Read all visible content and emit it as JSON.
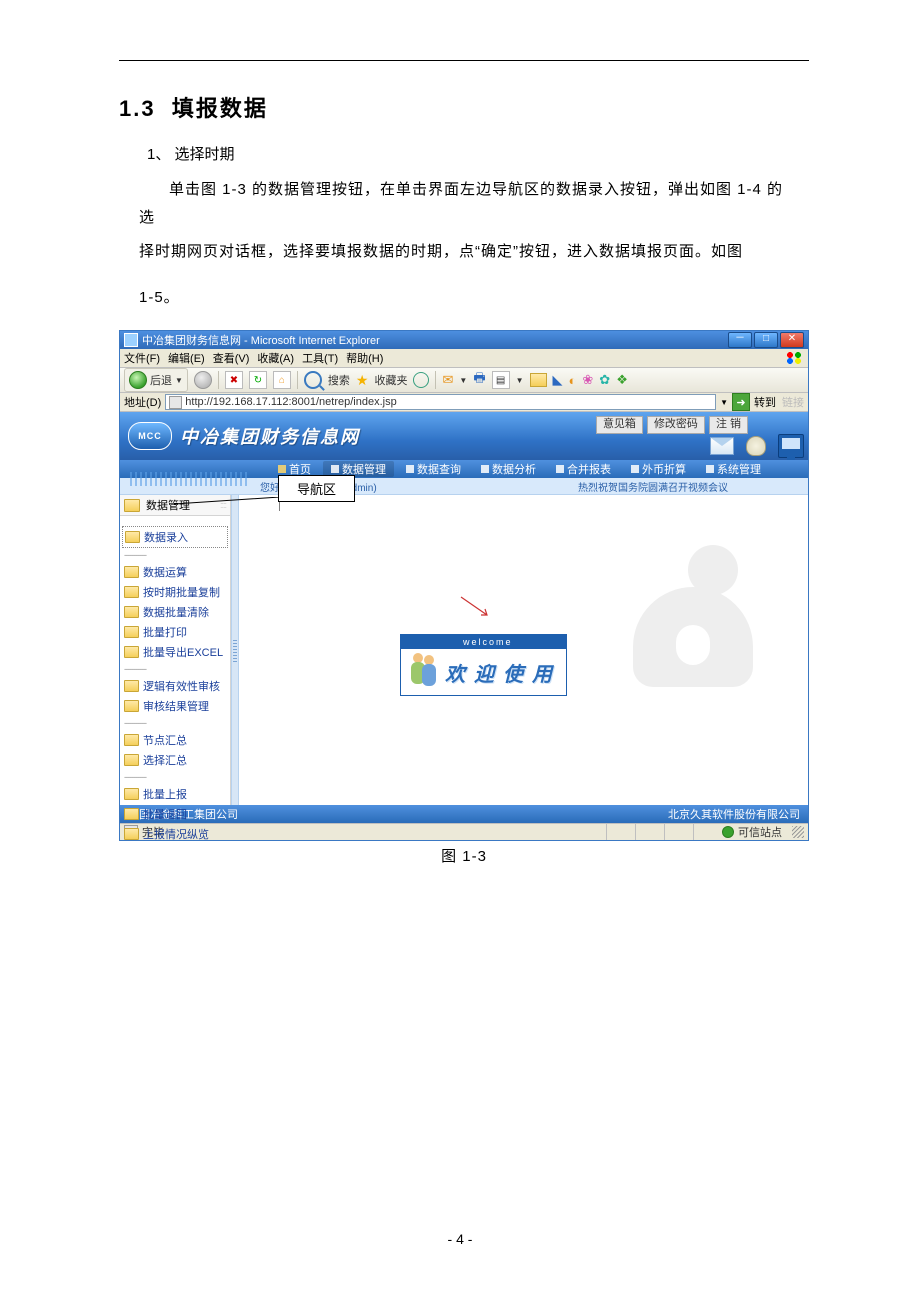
{
  "doc": {
    "section_number": "1.3",
    "section_title": "填报数据",
    "step_number": "1、",
    "step_title": "选择时期",
    "paragraph1": "单击图 1-3 的数据管理按钮，在单击界面左边导航区的数据录入按钮，弹出如图 1-4 的选",
    "paragraph2": "择时期网页对话框，选择要填报数据的时期，点“确定”按钮，进入数据填报页面。如图",
    "paragraph3": "1-5。",
    "figure_caption": "图 1-3",
    "page_number": "- 4 -",
    "callout_label": "导航区"
  },
  "ie": {
    "title": "中冶集团财务信息网 - Microsoft Internet Explorer",
    "menus": [
      "文件(F)",
      "编辑(E)",
      "查看(V)",
      "收藏(A)",
      "工具(T)",
      "帮助(H)"
    ],
    "back": "后退",
    "search": "搜索",
    "fav": "收藏夹",
    "addr_label": "地址(D)",
    "url": "http://192.168.17.112:8001/netrep/index.jsp",
    "go": "转到",
    "links": "链接",
    "status_done": "完毕",
    "trusted": "可信站点"
  },
  "app": {
    "logo_text": "MCC",
    "title": "中冶集团财务信息网",
    "header_btns": [
      "意见箱",
      "修改密码",
      "注 销"
    ],
    "nav": [
      "首页",
      "数据管理",
      "数据查询",
      "数据分析",
      "合并报表",
      "外币折算",
      "系统管理"
    ],
    "welcome_left": "您好：系统管理员 (admin)",
    "welcome_right": "热烈祝贺国务院圆满召开视频会议",
    "sidebar_header": "数据管理",
    "sidebar": {
      "g1": [
        "数据录入"
      ],
      "g2": [
        "数据运算",
        "按时期批量复制",
        "数据批量清除",
        "批量打印",
        "批量导出EXCEL"
      ],
      "g3": [
        "逻辑有效性审核",
        "审核结果管理"
      ],
      "g4": [
        "节点汇总",
        "选择汇总"
      ],
      "g5": [
        "批量上报",
        "批量退回",
        "上报情况纵览"
      ]
    },
    "welcome_card_top": "welcome",
    "welcome_card_text": "欢 迎 使 用",
    "footer_left": "中国冶金科工集团公司",
    "footer_right": "北京久其软件股份有限公司"
  }
}
